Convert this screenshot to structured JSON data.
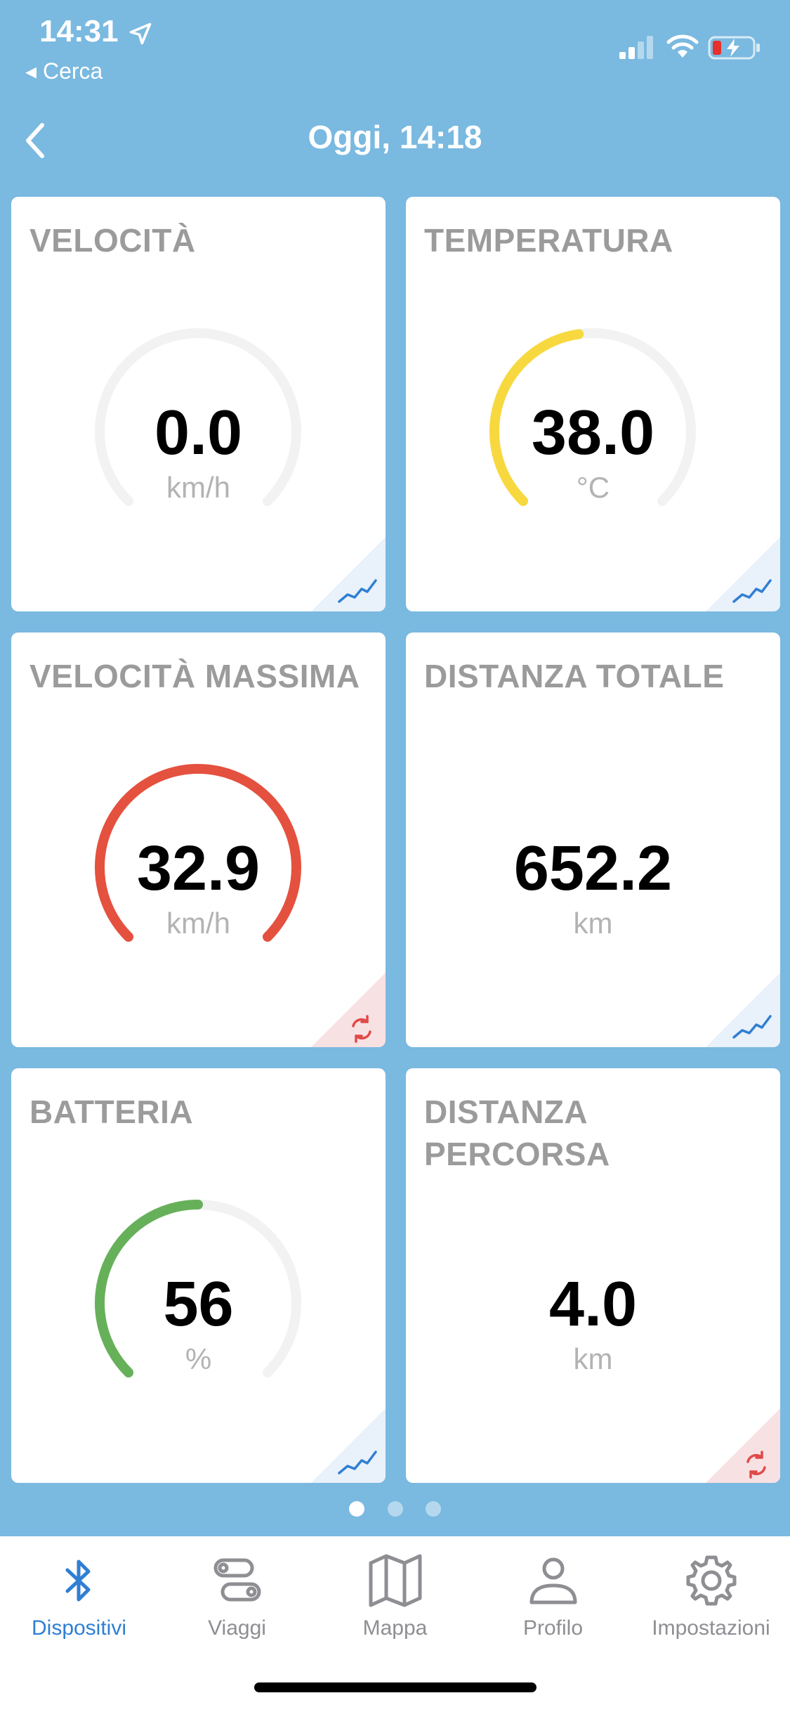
{
  "status_bar": {
    "time": "14:31",
    "back_app": "◂ Cerca",
    "icons": [
      "location-arrow-icon",
      "signal-icon",
      "wifi-icon",
      "battery-charging-icon"
    ]
  },
  "header": {
    "title": "Oggi, 14:18",
    "back_icon": "chevron-left-icon"
  },
  "colors": {
    "background": "#7AB9E0",
    "track": "#F2F2F2",
    "temperature": "#F7D93F",
    "max_speed": "#E5513F",
    "battery": "#67B05A",
    "chart_accent": "#2F7FD3",
    "reset_accent": "#E04A4A"
  },
  "cards": [
    {
      "title": "VELOCITÀ",
      "value": "0.0",
      "unit": "km/h",
      "gauge_fraction": 0.0,
      "corner_icon": "chart-line-icon"
    },
    {
      "title": "TEMPERATURA",
      "value": "38.0",
      "unit": "°C",
      "gauge_fraction": 0.47,
      "corner_icon": "chart-line-icon"
    },
    {
      "title": "VELOCITÀ MASSIMA",
      "value": "32.9",
      "unit": "km/h",
      "gauge_fraction": 1.0,
      "corner_icon": "refresh-icon"
    },
    {
      "title": "DISTANZA TOTALE",
      "value": "652.2",
      "unit": "km",
      "corner_icon": "chart-line-icon"
    },
    {
      "title": "BATTERIA",
      "value": "56",
      "unit": "%",
      "gauge_fraction": 0.5,
      "corner_icon": "chart-line-icon"
    },
    {
      "title": "DISTANZA PERCORSA",
      "value": "4.0",
      "unit": "km",
      "corner_icon": "refresh-icon"
    }
  ],
  "pagination": {
    "pages": 3,
    "current": 1
  },
  "tabbar": {
    "tabs": [
      {
        "label": "Dispositivi",
        "icon": "bluetooth-icon",
        "active": true
      },
      {
        "label": "Viaggi",
        "icon": "route-icon",
        "active": false
      },
      {
        "label": "Mappa",
        "icon": "map-icon",
        "active": false
      },
      {
        "label": "Profilo",
        "icon": "person-icon",
        "active": false
      },
      {
        "label": "Impostazioni",
        "icon": "gear-icon",
        "active": false
      }
    ]
  }
}
